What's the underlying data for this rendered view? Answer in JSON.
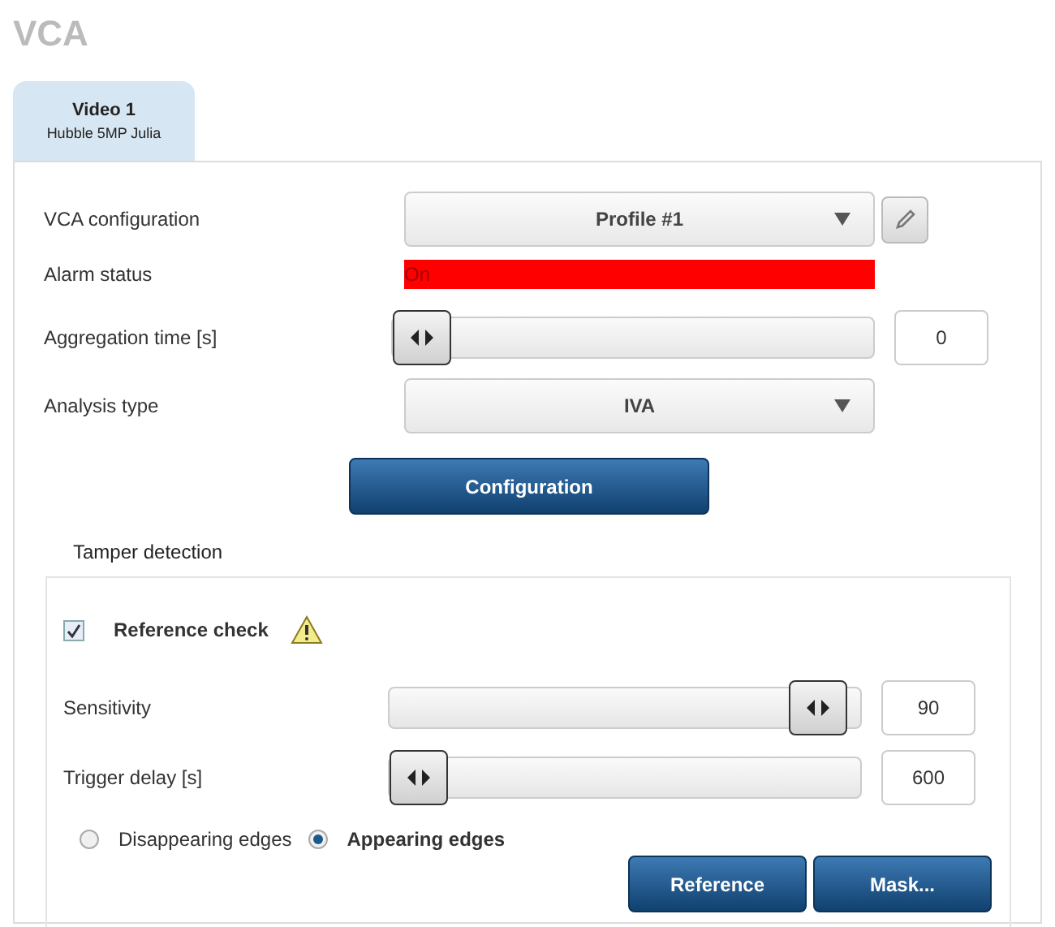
{
  "page_title": "VCA",
  "tabs": [
    {
      "label": "Video 1",
      "sublabel": "Hubble 5MP Julia",
      "selected": true
    }
  ],
  "vca_configuration": {
    "label": "VCA configuration",
    "value": "Profile #1"
  },
  "alarm_status": {
    "label": "Alarm status",
    "value": "On",
    "on": true
  },
  "aggregation_time": {
    "label": "Aggregation time [s]",
    "level": 0,
    "reading": "0"
  },
  "analysis_type": {
    "label": "Analysis type",
    "value": "IVA"
  },
  "configuration_button": "Configuration",
  "tamper_detection": {
    "title": "Tamper detection",
    "reference_check": {
      "label": "Reference check",
      "checked": true
    },
    "sliders": [
      {
        "label": "Sensitivity",
        "level": 0.96,
        "reading": "90"
      },
      {
        "label": "Trigger delay [s]",
        "level": 0,
        "reading": "600"
      }
    ],
    "edges": [
      {
        "label": "Disappearing edges",
        "selected": false
      },
      {
        "label": "Appearing edges",
        "selected": true
      }
    ],
    "buttons": [
      "Reference",
      "Mask..."
    ]
  }
}
